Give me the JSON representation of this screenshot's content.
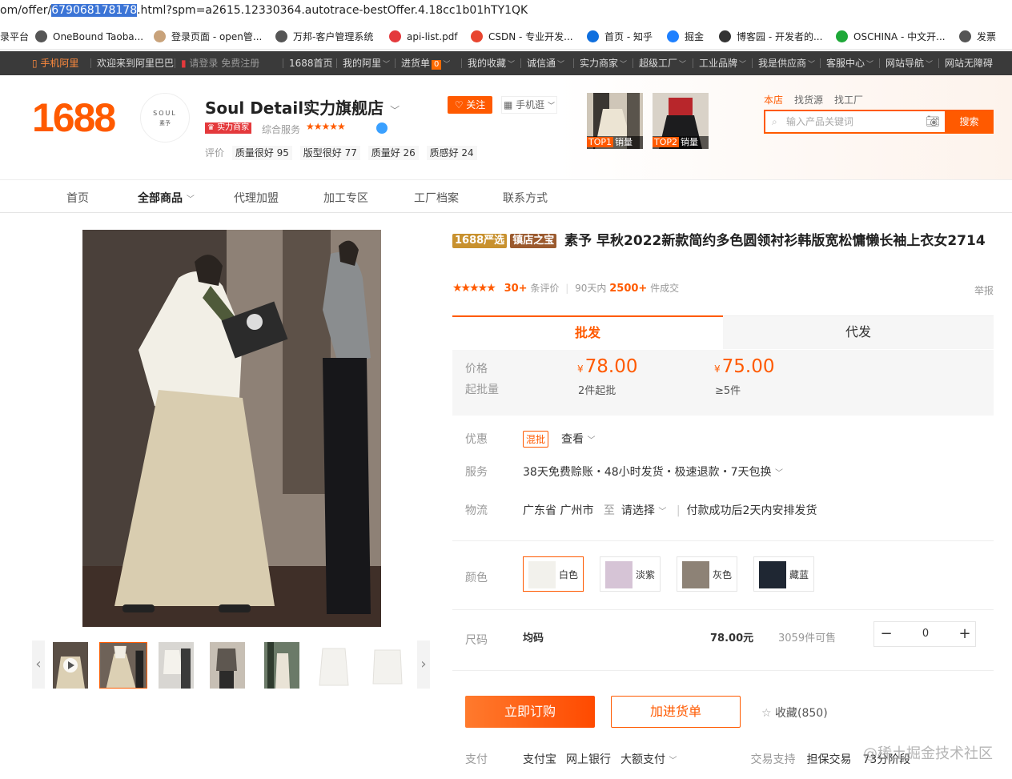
{
  "addressbar": {
    "prefix": "om/offer/",
    "highlight": "679068178178",
    "suffix": ".html?spm=a2615.12330364.autotrace-bestOffer.4.18cc1b01hTY1QK"
  },
  "bookmarks": [
    {
      "label": "录平台",
      "icon": "partial-icon",
      "color": "#666"
    },
    {
      "label": "OneBound Taoba...",
      "icon": "globe-icon",
      "color": "#555"
    },
    {
      "label": "登录页面 - open管...",
      "icon": "page-thumb-icon",
      "color": "#c8a27a"
    },
    {
      "label": "万邦-客户管理系统",
      "icon": "globe-icon",
      "color": "#555"
    },
    {
      "label": "api-list.pdf",
      "icon": "oxe-icon",
      "color": "#e4393c"
    },
    {
      "label": "CSDN - 专业开发...",
      "icon": "csdn-icon",
      "color": "#e8452f"
    },
    {
      "label": "首页 - 知乎",
      "icon": "zhihu-icon",
      "color": "#0f6fde"
    },
    {
      "label": "掘金",
      "icon": "juejin-icon",
      "color": "#1e80ff"
    },
    {
      "label": "博客园 - 开发者的...",
      "icon": "cnblogs-icon",
      "color": "#333"
    },
    {
      "label": "OSCHINA - 中文开...",
      "icon": "oschina-icon",
      "color": "#1ea838"
    },
    {
      "label": "发票",
      "icon": "globe-icon",
      "color": "#555"
    }
  ],
  "topbar": {
    "items": [
      {
        "label": "手机阿里",
        "orange": true
      },
      {
        "label": "欢迎来到阿里巴巴"
      },
      {
        "label": "请登录 免费注册",
        "faded": true
      },
      {
        "label": "1688首页"
      },
      {
        "label": "我的阿里",
        "arrow": true
      },
      {
        "label": "进货单",
        "badge": "0",
        "arrow": true
      },
      {
        "label": "我的收藏",
        "arrow": true
      },
      {
        "label": "诚信通",
        "arrow": true
      },
      {
        "label": "实力商家",
        "arrow": true
      },
      {
        "label": "超级工厂",
        "arrow": true
      },
      {
        "label": "工业品牌",
        "arrow": true
      },
      {
        "label": "我是供应商",
        "arrow": true
      },
      {
        "label": "客服中心",
        "arrow": true
      },
      {
        "label": "网站导航",
        "arrow": true
      },
      {
        "label": "网站无障碍"
      }
    ]
  },
  "shop": {
    "logo": "1688",
    "avatar_text": "SOUL",
    "avatar_sub": "素予",
    "name": "Soul Detail实力旗舰店",
    "badge": "实力商家",
    "service_label": "综合服务",
    "stars": "★★★★★",
    "ratings_label": "评价",
    "ratings": [
      "质量很好 95",
      "版型很好 77",
      "质量好 26",
      "质感好 24"
    ],
    "follow": "关注",
    "mobile": "手机逛",
    "top_products": [
      {
        "rank": "TOP1",
        "label": "销量"
      },
      {
        "rank": "TOP2",
        "label": "销量"
      }
    ]
  },
  "search": {
    "tabs": [
      "本店",
      "找货源",
      "找工厂"
    ],
    "placeholder": "输入产品关键词",
    "button": "搜索"
  },
  "nav": [
    "首页",
    "全部商品",
    "代理加盟",
    "加工专区",
    "工厂档案",
    "联系方式"
  ],
  "product": {
    "tags": [
      {
        "label": "1688严选",
        "color": "#c8912e"
      },
      {
        "label": "镇店之宝",
        "color": "#9b5a2e"
      }
    ],
    "title": "素予 早秋2022新款简约多色圆领衬衫韩版宽松慵懒长袖上衣女2714",
    "stars": "★★★★★",
    "reviews_count": "30+",
    "reviews_label": "条评价",
    "period": "90天内",
    "sold": "2500+",
    "sold_label": "件成交",
    "report": "举报",
    "tabs": [
      "批发",
      "代发"
    ],
    "price_label": "价格",
    "moq_label": "起批量",
    "prices": [
      {
        "currency": "¥",
        "price": "78.00",
        "qty": "2件起批"
      },
      {
        "currency": "¥",
        "price": "75.00",
        "qty": "≥5件"
      }
    ],
    "promo_label": "优惠",
    "promo_tag": "混批",
    "promo_view": "查看",
    "service_label": "服务",
    "service_text": "38天免费赊账・48小时发货・极速退款・7天包换",
    "logistics_label": "物流",
    "logistics_from": "广东省 广州市",
    "logistics_to_word": "至",
    "logistics_select": "请选择",
    "logistics_note": "付款成功后2天内安排发货",
    "color_label": "颜色",
    "colors": [
      {
        "name": "白色",
        "swatch": "#f2f1ec"
      },
      {
        "name": "淡紫",
        "swatch": "#d6c4d6"
      },
      {
        "name": "灰色",
        "swatch": "#8d8276"
      },
      {
        "name": "藏蓝",
        "swatch": "#1f2733"
      }
    ],
    "size_label": "尺码",
    "size_name": "均码",
    "size_price": "78.00元",
    "size_stock": "3059件可售",
    "qty": "0",
    "buy": "立即订购",
    "cart": "加进货单",
    "fav": "收藏(850)",
    "pay_label": "支付",
    "pay_methods": [
      "支付宝",
      "网上银行",
      "大额支付"
    ],
    "trade_label": "交易支持",
    "trade_items": [
      "担保交易",
      "73分阶段"
    ]
  },
  "watermark": "@稀土掘金技术社区"
}
